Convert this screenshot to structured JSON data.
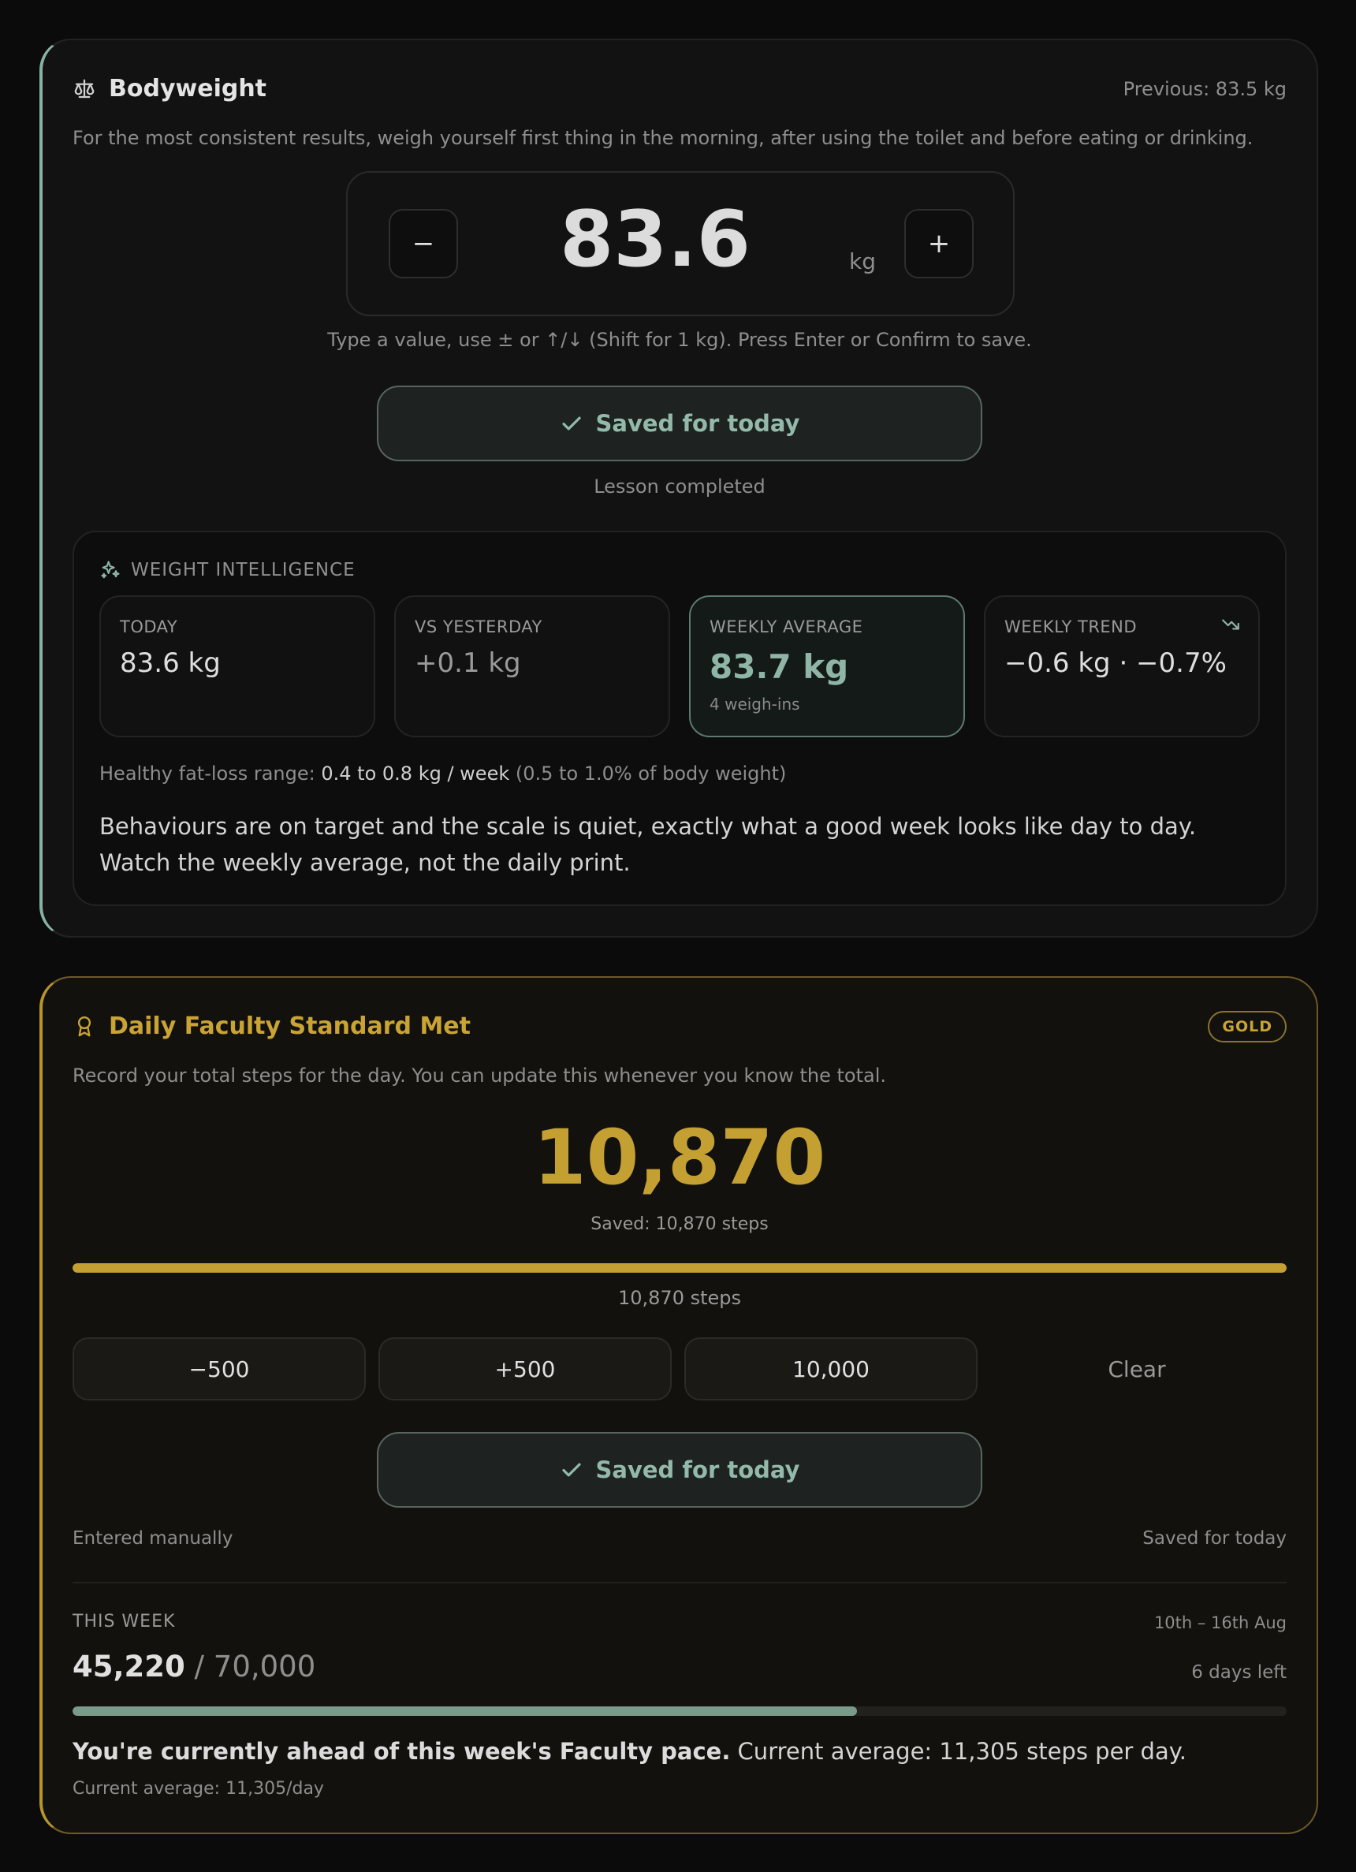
{
  "bodyweight": {
    "title": "Bodyweight",
    "previous": "Previous: 83.5 kg",
    "description": "For the most consistent results, weigh yourself first thing in the morning, after using the toilet and before eating or drinking.",
    "value": "83.6",
    "unit": "kg",
    "minus_label": "−",
    "plus_label": "+",
    "hint": "Type a value, use ± or ↑/↓ (Shift for 1 kg). Press Enter or Confirm to save.",
    "saved_label": "Saved for today",
    "lesson_status": "Lesson completed",
    "intelligence": {
      "heading": "WEIGHT INTELLIGENCE",
      "stats": [
        {
          "label": "TODAY",
          "value": "83.6 kg"
        },
        {
          "label": "VS YESTERDAY",
          "value": "+0.1 kg"
        },
        {
          "label": "WEEKLY AVERAGE",
          "value": "83.7 kg",
          "sub": "4 weigh-ins"
        },
        {
          "label": "WEEKLY TREND",
          "value": "−0.6 kg · −0.7%"
        }
      ],
      "range_prefix": "Healthy fat-loss range:",
      "range_value": "0.4 to 0.8 kg / week",
      "range_suffix": "(0.5 to 1.0% of body weight)",
      "message": "Behaviours are on target and the scale is quiet, exactly what a good week looks like day to day. Watch the weekly average, not the daily print."
    }
  },
  "steps": {
    "title": "Daily Faculty Standard Met",
    "badge": "GOLD",
    "description": "Record your total steps for the day. You can update this whenever you know the total.",
    "value": "10,870",
    "saved_text": "Saved: 10,870 steps",
    "progress_fraction": 1.0,
    "progress_caption": "10,870 steps",
    "quick_buttons": [
      "−500",
      "+500",
      "10,000"
    ],
    "clear_label": "Clear",
    "saved_label": "Saved for today",
    "entry_source": "Entered manually",
    "entry_status": "Saved for today",
    "week": {
      "label": "THIS WEEK",
      "dates": "10th – 16th Aug",
      "total": "45,220",
      "goal": "/ 70,000",
      "days_left": "6 days left",
      "progress_fraction": 0.646,
      "pace_bold": "You're currently ahead of this week's Faculty pace.",
      "pace_rest": " Current average: 11,305 steps per day.",
      "average": "Current average: 11,305/day"
    }
  },
  "colors": {
    "weight_accent": "#88b3a4",
    "gold_accent": "#c4a033",
    "week_progress": "#7a9a8a"
  },
  "icons": {
    "bodyweight": "scale-icon",
    "intelligence": "sparkles-icon",
    "trend": "trending-down-icon",
    "steps": "award-ribbon-icon",
    "saved": "check-icon"
  }
}
